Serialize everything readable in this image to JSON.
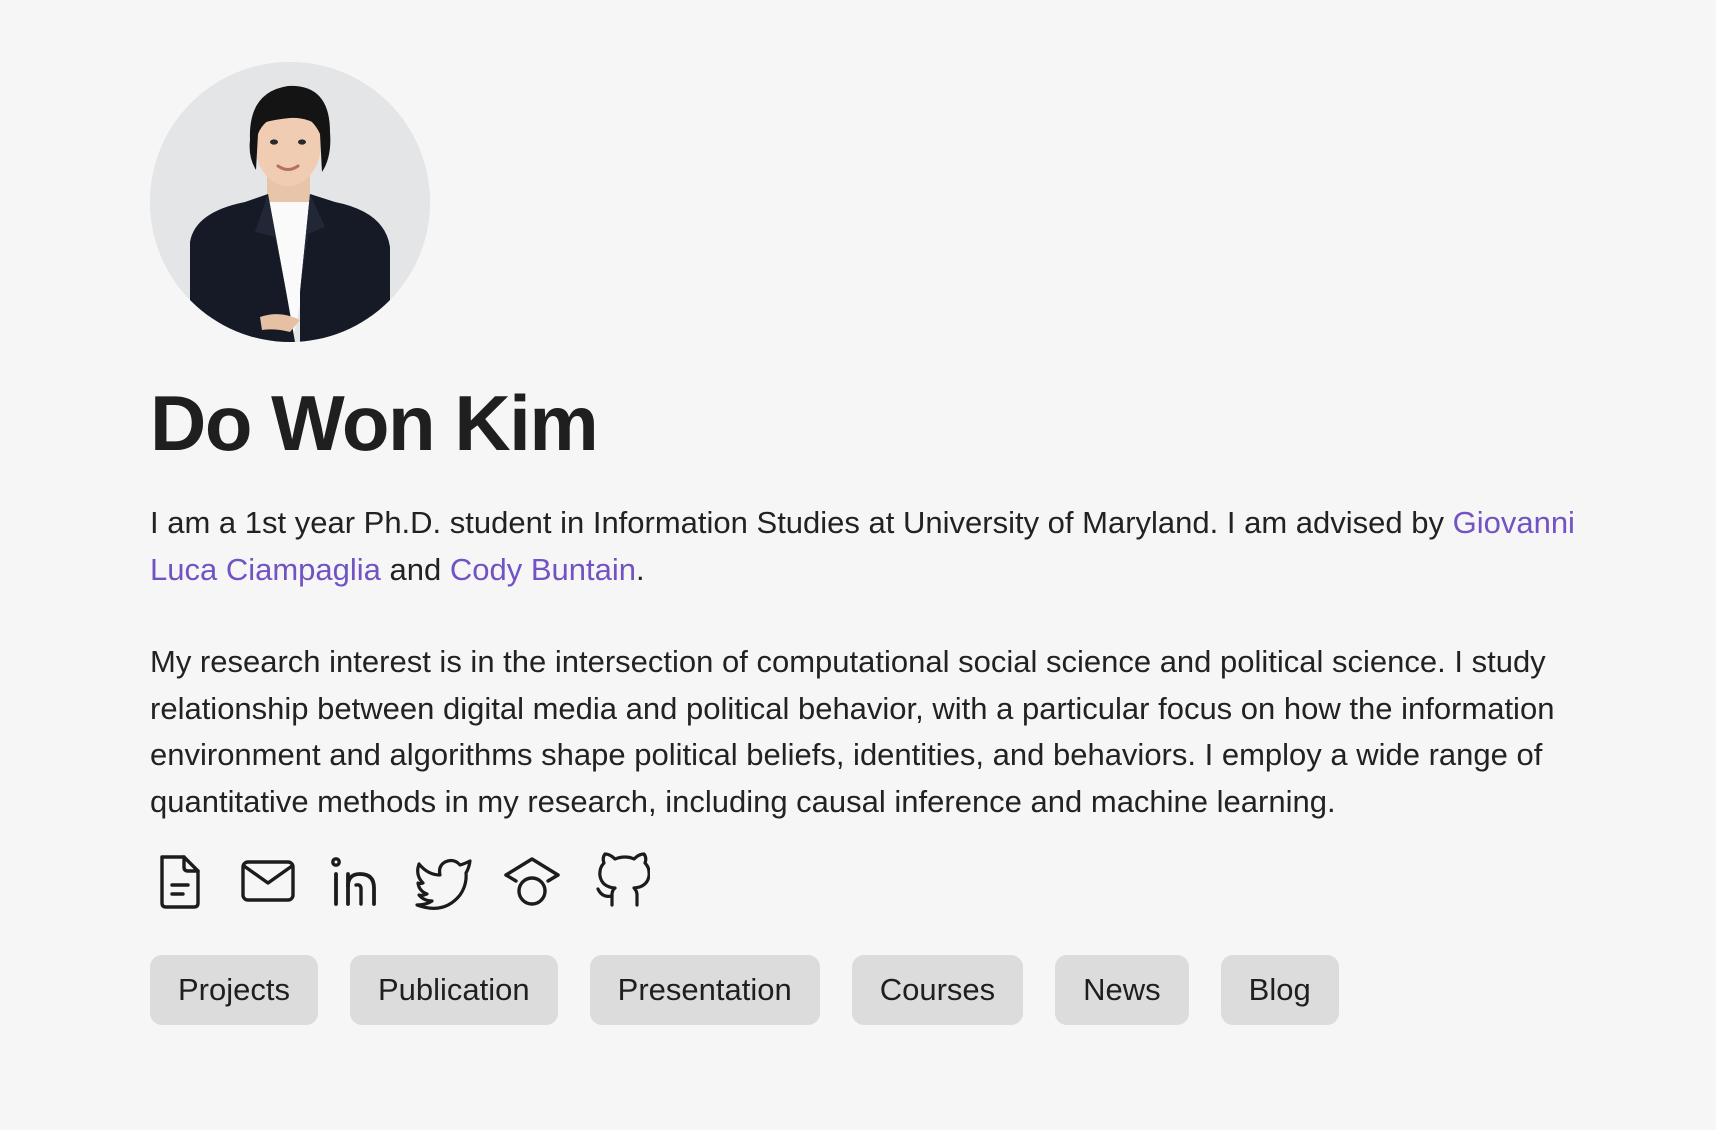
{
  "profile": {
    "name": "Do Won Kim",
    "bio": {
      "p1_before": "I am a 1st year Ph.D. student in Information Studies at University of Maryland. I am advised by ",
      "advisor1": "Giovanni Luca Ciampaglia",
      "and": " and ",
      "advisor2": "Cody Buntain",
      "period": ".",
      "p2": "My research interest is in the intersection of computational social science and political science. I study relationship between digital media and political behavior, with a particular focus on how the information environment and algorithms shape political beliefs, identities, and behaviors. I employ a wide range of quantitative methods in my research, including causal inference and machine learning."
    }
  },
  "links": [
    {
      "icon": "cv-document-icon"
    },
    {
      "icon": "email-icon"
    },
    {
      "icon": "linkedin-icon"
    },
    {
      "icon": "twitter-icon"
    },
    {
      "icon": "google-scholar-icon"
    },
    {
      "icon": "github-icon"
    }
  ],
  "nav": {
    "projects": "Projects",
    "publication": "Publication",
    "presentation": "Presentation",
    "courses": "Courses",
    "news": "News",
    "blog": "Blog"
  },
  "colors": {
    "background": "#f6f6f6",
    "link": "#7253c4",
    "button_bg": "#dcdcdc",
    "text": "#1c1c1c"
  }
}
